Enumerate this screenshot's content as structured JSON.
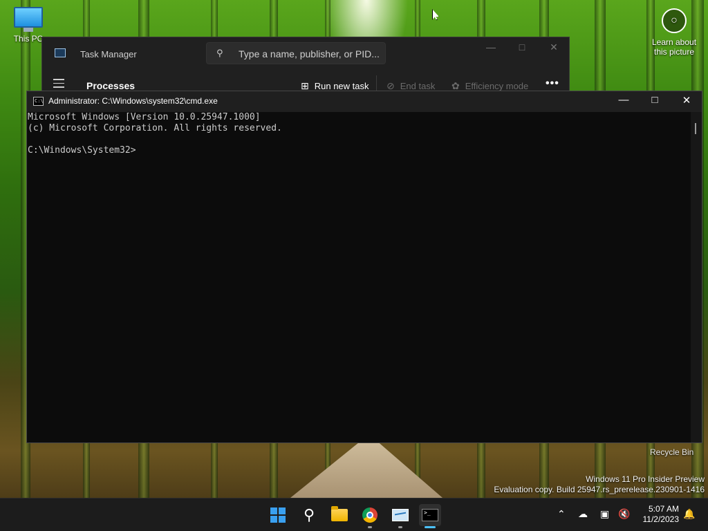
{
  "desktop": {
    "this_pc_label": "This PC",
    "learn_label_1": "Learn about",
    "learn_label_2": "this picture",
    "recycle_bin_label": "Recycle Bin",
    "watermark_line1": "Windows 11 Pro Insider Preview",
    "watermark_line2": "Evaluation copy. Build 25947.rs_prerelease.230901-1416"
  },
  "task_manager": {
    "title": "Task Manager",
    "search_placeholder": "Type a name, publisher, or PID...",
    "section": "Processes",
    "run_new_task": "Run new task",
    "end_task": "End task",
    "efficiency_mode": "Efficiency mode",
    "more": "•••"
  },
  "cmd": {
    "title": "Administrator: C:\\Windows\\system32\\cmd.exe",
    "lines": [
      "Microsoft Windows [Version 10.0.25947.1000]",
      "(c) Microsoft Corporation. All rights reserved.",
      "",
      "C:\\Windows\\System32>"
    ]
  },
  "taskbar": {
    "time": "5:07 AM",
    "date": "11/2/2023",
    "apps": [
      "start-icon",
      "search-icon",
      "file-explorer-icon",
      "chrome-icon",
      "task-manager-icon",
      "terminal-icon"
    ]
  },
  "colors": {
    "accent": "#4cc2ff",
    "cmd_background": "#0c0c0c",
    "cmd_text": "#cccccc",
    "taskbar": "#1c1c1c"
  }
}
